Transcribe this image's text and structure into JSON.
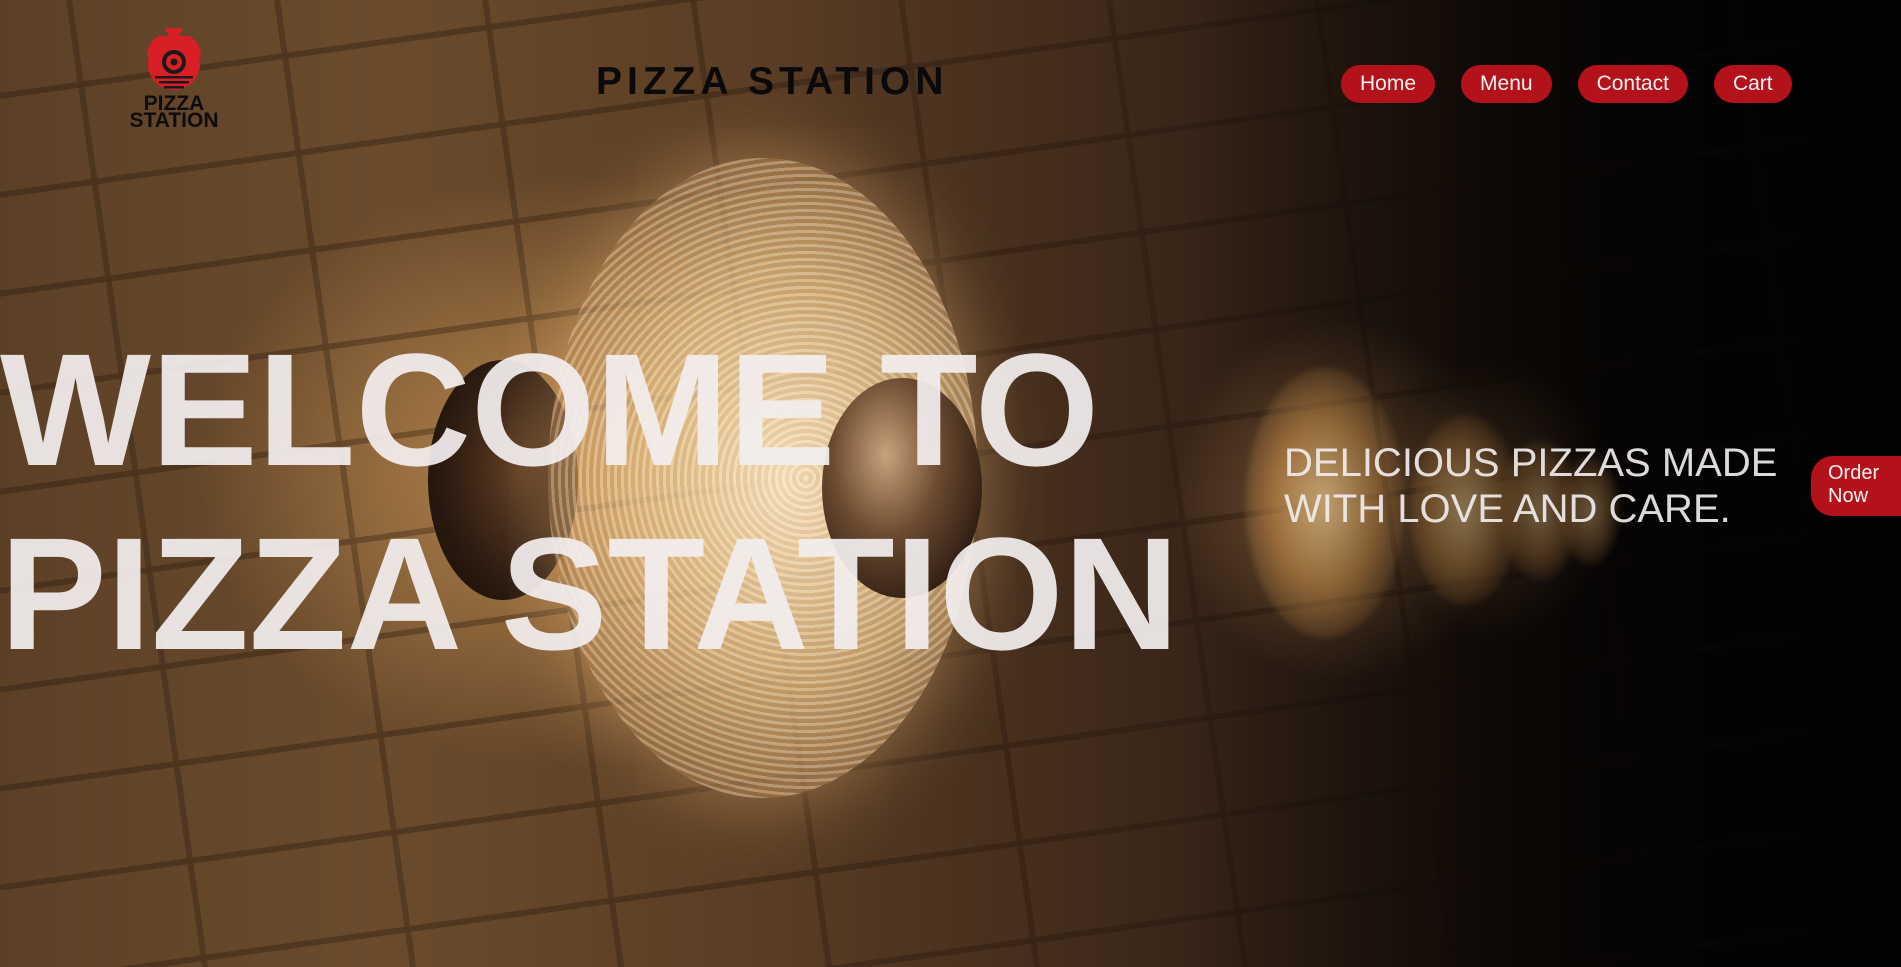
{
  "brand": {
    "logo_line1": "PIZZA",
    "logo_line2": "STATION",
    "logo_icon": "pizza-station-emblem-icon",
    "site_title": "PIZZA STATION"
  },
  "nav": {
    "items": [
      {
        "label": "Home"
      },
      {
        "label": "Menu"
      },
      {
        "label": "Contact"
      },
      {
        "label": "Cart"
      }
    ]
  },
  "hero": {
    "title_line1": "WELCOME TO",
    "title_line2": "PIZZA STATION",
    "tagline": "DELICIOUS PIZZAS MADE WITH LOVE AND CARE.",
    "cta_line1": "Order",
    "cta_line2": "Now"
  },
  "colors": {
    "accent": "#b3121b",
    "hero_text": "#f2eeee",
    "logo_text": "#0c0c0c"
  }
}
